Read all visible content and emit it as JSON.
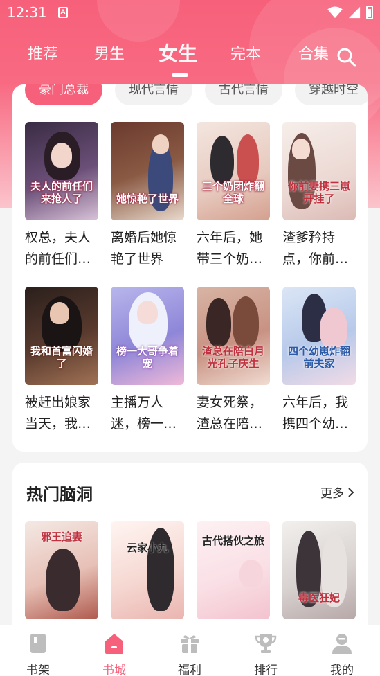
{
  "status_bar": {
    "time": "12:31",
    "notification": "A"
  },
  "top_tabs": [
    {
      "label": "推荐",
      "active": false
    },
    {
      "label": "男生",
      "active": false
    },
    {
      "label": "女生",
      "active": true
    },
    {
      "label": "完本",
      "active": false
    },
    {
      "label": "合集",
      "active": false
    }
  ],
  "colors": {
    "accent": "#f7607a",
    "header": "#f86a82"
  },
  "categories": [
    "豪门总裁",
    "现代言情",
    "古代言情",
    "穿越时空"
  ],
  "books_row1": [
    {
      "title": "权总，夫人的前任们来抢人了",
      "cover_text": "夫人的前任们来抢人了"
    },
    {
      "title": "离婚后她惊艳了世界",
      "cover_text": "她惊艳了世界"
    },
    {
      "title": "六年后，她带三个奶团炸翻全球",
      "cover_text": "三个奶团炸翻全球"
    },
    {
      "title": "渣爹矜持点，你前妻携三崽开挂了",
      "cover_text": "你前妻携三崽开挂了"
    }
  ],
  "books_row2": [
    {
      "title": "被赶出娘家当天，我和首富闪婚了",
      "cover_text": "我和首富闪婚了"
    },
    {
      "title": "主播万人迷，榜一大哥争着宠",
      "cover_text": "榜一大哥争着宠"
    },
    {
      "title": "妻女死祭，渣总在陪白月光孔子庆生",
      "cover_text": "渣总在陪白月光孔子庆生"
    },
    {
      "title": "六年后，我携四个幼崽炸翻前夫家",
      "cover_text": "四个幼崽炸翻前夫家"
    }
  ],
  "section_hot": {
    "title": "热门脑洞",
    "more_label": "更多"
  },
  "books_hot": [
    {
      "cover_text": "邪王追妻"
    },
    {
      "cover_text": "云家小九"
    },
    {
      "cover_text": "古代搭伙之旅"
    },
    {
      "cover_text": "毒医狂妃"
    }
  ],
  "bottom_nav": [
    {
      "label": "书架",
      "icon": "bookshelf-icon",
      "active": false
    },
    {
      "label": "书城",
      "icon": "bookstore-icon",
      "active": true
    },
    {
      "label": "福利",
      "icon": "gift-icon",
      "active": false
    },
    {
      "label": "排行",
      "icon": "trophy-icon",
      "active": false
    },
    {
      "label": "我的",
      "icon": "profile-icon",
      "active": false
    }
  ]
}
